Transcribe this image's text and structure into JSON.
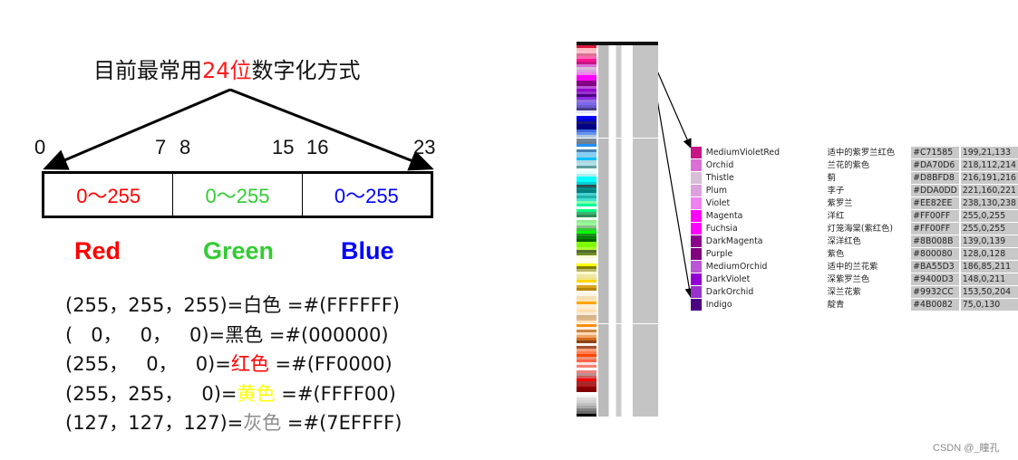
{
  "title": {
    "prefix": "目前最常用",
    "highlight": "24位",
    "suffix": "数字化方式"
  },
  "bit_positions": [
    "0",
    "7",
    "8",
    "15",
    "16",
    "23"
  ],
  "channels": [
    {
      "range": "0～255",
      "label": "Red",
      "color": "#ff0000"
    },
    {
      "range": "0～255",
      "label": "Green",
      "color": "#33cc33"
    },
    {
      "range": "0～255",
      "label": "Blue",
      "color": "#0000ff"
    }
  ],
  "examples": [
    {
      "rgb": "(255，255，255)=",
      "name": "白色",
      "name_color": "#111111",
      "hex": " =#(FFFFFF)"
    },
    {
      "rgb": "(   0，   0，   0)=",
      "name": "黑色",
      "name_color": "#111111",
      "hex": " =#(000000)"
    },
    {
      "rgb": "(255，   0，   0)=",
      "name": "红色",
      "name_color": "#ff0000",
      "hex": " =#(FF0000)"
    },
    {
      "rgb": "(255，255，   0)=",
      "name": "黄色",
      "name_color": "#ffff00",
      "hex": " =#(FFFF00)"
    },
    {
      "rgb": "(127，127，127)=",
      "name": "灰色",
      "name_color": "#8c8c8c",
      "hex": " =#(7EFFFF)"
    }
  ],
  "color_table": [
    {
      "swatch": "#C71585",
      "en": "MediumVioletRed",
      "zh": "适中的紫罗兰红色",
      "hex": "#C71585",
      "rgb": "199,21,133"
    },
    {
      "swatch": "#DA70D6",
      "en": "Orchid",
      "zh": "兰花的紫色",
      "hex": "#DA70D6",
      "rgb": "218,112,214"
    },
    {
      "swatch": "#D8BFD8",
      "en": "Thistle",
      "zh": "蓟",
      "hex": "#D8BFD8",
      "rgb": "216,191,216"
    },
    {
      "swatch": "#DDA0DD",
      "en": "Plum",
      "zh": "李子",
      "hex": "#DDA0DD",
      "rgb": "221,160,221"
    },
    {
      "swatch": "#EE82EE",
      "en": "Violet",
      "zh": "紫罗兰",
      "hex": "#EE82EE",
      "rgb": "238,130,238"
    },
    {
      "swatch": "#FF00FF",
      "en": "Magenta",
      "zh": "洋红",
      "hex": "#FF00FF",
      "rgb": "255,0,255"
    },
    {
      "swatch": "#FF00FF",
      "en": "Fuchsia",
      "zh": "灯笼海棠(紫红色)",
      "hex": "#FF00FF",
      "rgb": "255,0,255"
    },
    {
      "swatch": "#8B008B",
      "en": "DarkMagenta",
      "zh": "深洋红色",
      "hex": "#8B008B",
      "rgb": "139,0,139"
    },
    {
      "swatch": "#800080",
      "en": "Purple",
      "zh": "紫色",
      "hex": "#800080",
      "rgb": "128,0,128"
    },
    {
      "swatch": "#BA55D3",
      "en": "MediumOrchid",
      "zh": "适中的兰花紫",
      "hex": "#BA55D3",
      "rgb": "186,85,211"
    },
    {
      "swatch": "#9400D3",
      "en": "DarkViolet",
      "zh": "深紫罗兰色",
      "hex": "#9400D3",
      "rgb": "148,0,211"
    },
    {
      "swatch": "#9932CC",
      "en": "DarkOrchid",
      "zh": "深兰花紫",
      "hex": "#9932CC",
      "rgb": "153,50,204"
    },
    {
      "swatch": "#4B0082",
      "en": "Indigo",
      "zh": "靛青",
      "hex": "#4B0082",
      "rgb": "75,0,130"
    }
  ],
  "palette_swatches": [
    "#dc143c",
    "#ffb6c1",
    "#ffc0cb",
    "#db7093",
    "#ff69b4",
    "#ff1493",
    "#c71585",
    "#da70d6",
    "#d8bfd8",
    "#dda0dd",
    "#ee82ee",
    "#ff00ff",
    "#ff00ff",
    "#8b008b",
    "#800080",
    "#ba55d3",
    "#9400d3",
    "#9932cc",
    "#4b0082",
    "#8a2be2",
    "#9370db",
    "#7b68ee",
    "#6a5acd",
    "#483d8b",
    "#e6e6fa",
    "#f8f8ff",
    "#0000ff",
    "#0000cd",
    "#191970",
    "#00008b",
    "#000080",
    "#4169e1",
    "#6495ed",
    "#b0c4de",
    "#778899",
    "#708090",
    "#1e90ff",
    "#f0f8ff",
    "#4682b4",
    "#87cefa",
    "#87ceeb",
    "#00bfff",
    "#add8e6",
    "#b0e0e6",
    "#5f9ea0",
    "#f0ffff",
    "#e1ffff",
    "#afeeee",
    "#00ffff",
    "#00ffff",
    "#00ced1",
    "#2f4f4f",
    "#008b8b",
    "#008080",
    "#48d1cc",
    "#20b2aa",
    "#40e0d0",
    "#7fffaa",
    "#00fa9a",
    "#f5fffa",
    "#00ff7f",
    "#3cb371",
    "#2e8b57",
    "#f0fff0",
    "#90ee90",
    "#98fb98",
    "#8fbc8f",
    "#32cd32",
    "#00ff00",
    "#228b22",
    "#008000",
    "#006400",
    "#7fff00",
    "#7cfc00",
    "#adff2f",
    "#556b2f",
    "#6b8e23",
    "#fafad2",
    "#fffff0",
    "#ffffe0",
    "#ffff00",
    "#808000",
    "#bdb76b",
    "#fffacd",
    "#eee8aa",
    "#f0e68c",
    "#ffd700",
    "#fff8dc",
    "#daa520",
    "#b8860b",
    "#fffaf0",
    "#fdf5e6",
    "#f5deb3",
    "#ffe4b5",
    "#ffa500",
    "#ffefd5",
    "#ffebcd",
    "#ffdead",
    "#faebd7",
    "#d2b48c",
    "#deb887",
    "#ffe4c4",
    "#ff8c00",
    "#faf0e6",
    "#cd853f",
    "#ffdab9",
    "#f4a460",
    "#d2691e",
    "#8b4513",
    "#fff5ee",
    "#a0522d",
    "#ffa07a",
    "#ff7f50",
    "#ff4500",
    "#e9967a",
    "#ff6347",
    "#ffe4e1",
    "#fa8072",
    "#fffafa",
    "#f08080",
    "#bc8f8f",
    "#cd5c5c",
    "#ff0000",
    "#a52a2a",
    "#b22222",
    "#8b0000",
    "#800000",
    "#ffffff",
    "#f5f5f5",
    "#dcdcdc",
    "#d3d3d3",
    "#c0c0c0",
    "#a9a9a9",
    "#808080",
    "#696969",
    "#000000"
  ],
  "watermark": "CSDN @_瞳孔"
}
